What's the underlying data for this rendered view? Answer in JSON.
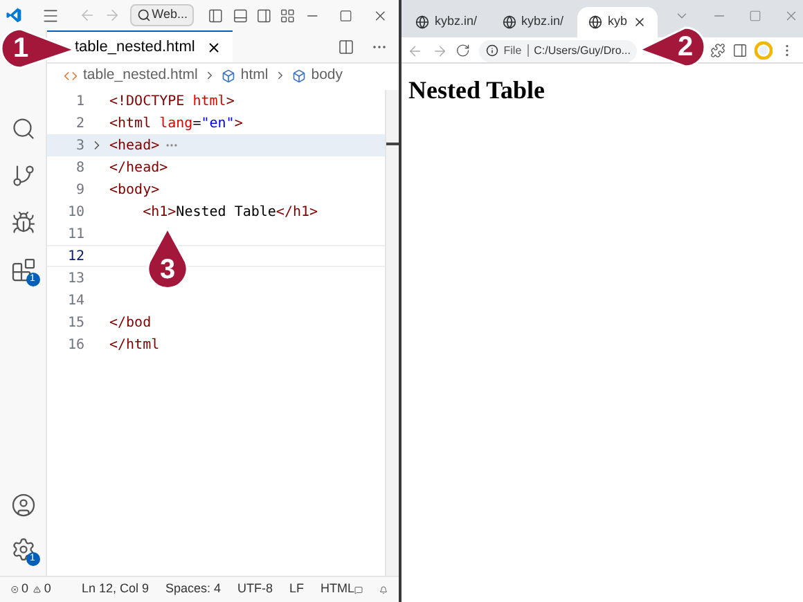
{
  "editor": {
    "title_search": "Web...",
    "tab": {
      "label": "table_nested.html",
      "selected": true
    },
    "breadcrumb": [
      "table_nested.html",
      "html",
      "body"
    ],
    "lines": [
      {
        "number": "1",
        "current": false,
        "folded": false,
        "tokens": [
          {
            "text": "<!DOCTYPE ",
            "kind": "tag"
          },
          {
            "text": "html",
            "kind": "attr"
          },
          {
            "text": ">",
            "kind": "tag"
          }
        ]
      },
      {
        "number": "2",
        "current": false,
        "folded": false,
        "tokens": [
          {
            "text": "<html ",
            "kind": "tag"
          },
          {
            "text": "lang",
            "kind": "attr"
          },
          {
            "text": "=",
            "kind": "plain"
          },
          {
            "text": "\"en\"",
            "kind": "string"
          },
          {
            "text": ">",
            "kind": "tag"
          }
        ]
      },
      {
        "number": "3",
        "current": false,
        "folded": true,
        "tokens": [
          {
            "text": "<head>",
            "kind": "tag"
          }
        ]
      },
      {
        "number": "8",
        "current": false,
        "folded": false,
        "tokens": [
          {
            "text": "</head>",
            "kind": "tag"
          }
        ]
      },
      {
        "number": "9",
        "current": false,
        "folded": false,
        "tokens": [
          {
            "text": "<body>",
            "kind": "tag"
          }
        ]
      },
      {
        "number": "10",
        "current": false,
        "folded": false,
        "tokens": [
          {
            "text": "    <h1>",
            "kind": "tag"
          },
          {
            "text": "Nested Table",
            "kind": "plain"
          },
          {
            "text": "</h1>",
            "kind": "tag"
          }
        ]
      },
      {
        "number": "11",
        "current": false,
        "folded": false
      },
      {
        "number": "12",
        "current": true,
        "folded": false
      },
      {
        "number": "13",
        "current": false,
        "folded": false
      },
      {
        "number": "14",
        "current": false,
        "folded": false
      },
      {
        "number": "15",
        "current": false,
        "folded": false,
        "tokens": [
          {
            "text": "</bod",
            "kind": "tag"
          }
        ]
      },
      {
        "number": "16",
        "current": false,
        "folded": false,
        "tokens": [
          {
            "text": "</html",
            "kind": "tag"
          }
        ]
      }
    ],
    "activity_badges": {
      "extensions": "1",
      "settings": "1"
    },
    "status_bar": {
      "errors": "0",
      "warnings": "0",
      "items": [
        "Ln 12, Col 9",
        "Spaces: 4",
        "UTF-8",
        "LF",
        "HTML"
      ]
    }
  },
  "browser": {
    "tabs": [
      {
        "label": "kybz.in/",
        "selected": false
      },
      {
        "label": "kybz.in/",
        "selected": false
      },
      {
        "label": "kyb",
        "selected": true
      }
    ],
    "address": {
      "scheme": "File",
      "url": "C:/Users/Guy/Dro..."
    },
    "heading": "Nested Table"
  },
  "callouts": [
    "1",
    "2",
    "3"
  ]
}
